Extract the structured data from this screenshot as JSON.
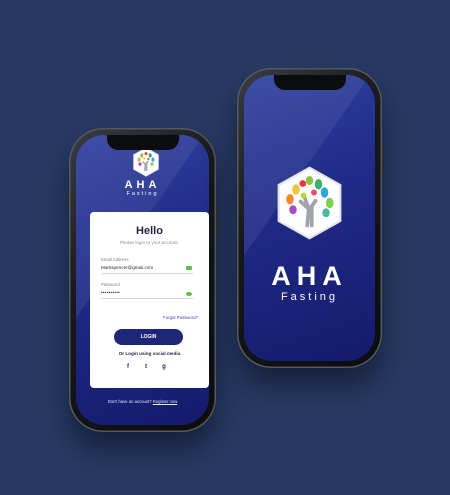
{
  "brand": {
    "name": "AHA",
    "tagline": "Fasting"
  },
  "login": {
    "title": "Hello",
    "subtitle": "Please login to your account.",
    "email_label": "Email Address",
    "email_value": "Markspencer@gmail.com",
    "password_label": "Password",
    "password_value": "••••••••••",
    "forgot": "Forgot Password?",
    "button": "LOGIN",
    "social_text": "Or Login using social media",
    "social": [
      "f",
      "t",
      "g"
    ],
    "register_prompt": "Don't have an account?",
    "register_link": "Register now"
  },
  "colors": {
    "background": "#283a63",
    "screen": "#1f2a86",
    "button": "#1e2678",
    "accent_green": "#5fbf4a"
  },
  "icons": [
    "mail-icon",
    "eye-icon",
    "facebook-icon",
    "twitter-icon",
    "google-icon",
    "tree-logo-icon"
  ]
}
